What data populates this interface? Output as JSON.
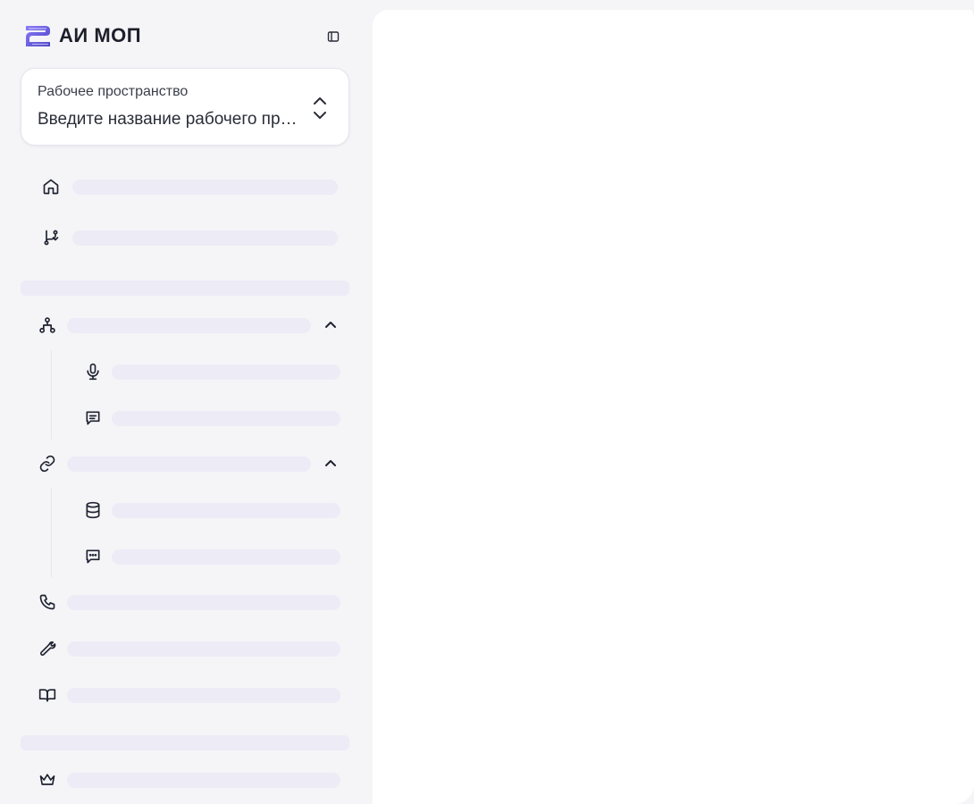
{
  "brand": {
    "name": "АИ МОП",
    "logo_icon": "brand-logo-icon",
    "accent_color": "#7a6ff0"
  },
  "workspace": {
    "label": "Рабочее пространство",
    "placeholder": "Введите название рабочего пространства"
  },
  "navigation": {
    "skeleton_color": "#ecebf6",
    "items": [
      {
        "icon": "home-icon"
      },
      {
        "icon": "git-branch-icon"
      },
      {
        "icon": "network-icon",
        "expanded": true,
        "children": [
          {
            "icon": "microphone-icon"
          },
          {
            "icon": "message-square-icon"
          }
        ]
      },
      {
        "icon": "link-icon",
        "expanded": true,
        "children": [
          {
            "icon": "database-icon"
          },
          {
            "icon": "message-dots-icon"
          }
        ]
      },
      {
        "icon": "phone-icon"
      },
      {
        "icon": "wrench-icon"
      },
      {
        "icon": "book-icon"
      },
      {
        "icon": "crown-icon"
      }
    ]
  }
}
